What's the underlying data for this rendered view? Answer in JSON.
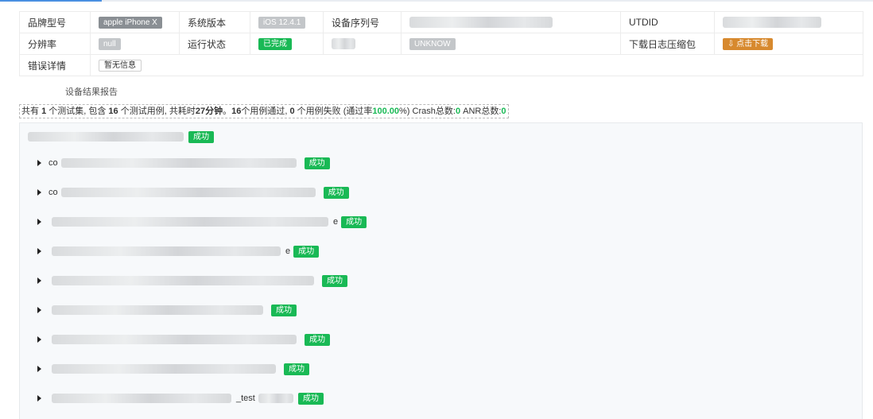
{
  "info": {
    "brand_label": "品牌型号",
    "brand_value": "apple iPhone X",
    "os_label": "系统版本",
    "os_value": "iOS 12.4.1",
    "serial_label": "设备序列号",
    "utdid_label": "UTDID",
    "resolution_label": "分辨率",
    "resolution_value": "null",
    "run_status_label": "运行状态",
    "run_status_value": "已完成",
    "unknown_value": "UNKNOW",
    "download_label": "下载日志压缩包",
    "download_button": "⇩ 点击下载",
    "error_label": "错误详情",
    "error_value": "暂无信息"
  },
  "report": {
    "title": "设备结果报告",
    "summary": {
      "p1": "共有 ",
      "sets": "1",
      "p2": " 个测试集, 包含 ",
      "cases": "16",
      "p3": " 个测试用例, 共耗时",
      "duration": "27分钟",
      "p4": "。",
      "passed": "16",
      "p5": "个用例通过, ",
      "failed": "0",
      "p6": " 个用例失败 (通过率",
      "rate": "100.00",
      "p7": "%) Crash总数:",
      "crash": "0",
      "p8": " ANR总数:",
      "anr": "0"
    }
  },
  "tree": {
    "root_status": "成功",
    "items": [
      {
        "prefix": "co",
        "suffix": "",
        "status": "成功"
      },
      {
        "prefix": "co",
        "suffix": "",
        "status": "成功"
      },
      {
        "prefix": "",
        "suffix": "e",
        "status": "成功"
      },
      {
        "prefix": "",
        "suffix": "e",
        "status": "成功"
      },
      {
        "prefix": "",
        "suffix": "",
        "status": "成功"
      },
      {
        "prefix": "",
        "suffix": "",
        "status": "成功"
      },
      {
        "prefix": "",
        "suffix": "",
        "status": "成功"
      },
      {
        "prefix": "",
        "suffix": "",
        "status": "成功"
      },
      {
        "prefix": "",
        "suffix": "_test",
        "status": "成功"
      }
    ]
  }
}
